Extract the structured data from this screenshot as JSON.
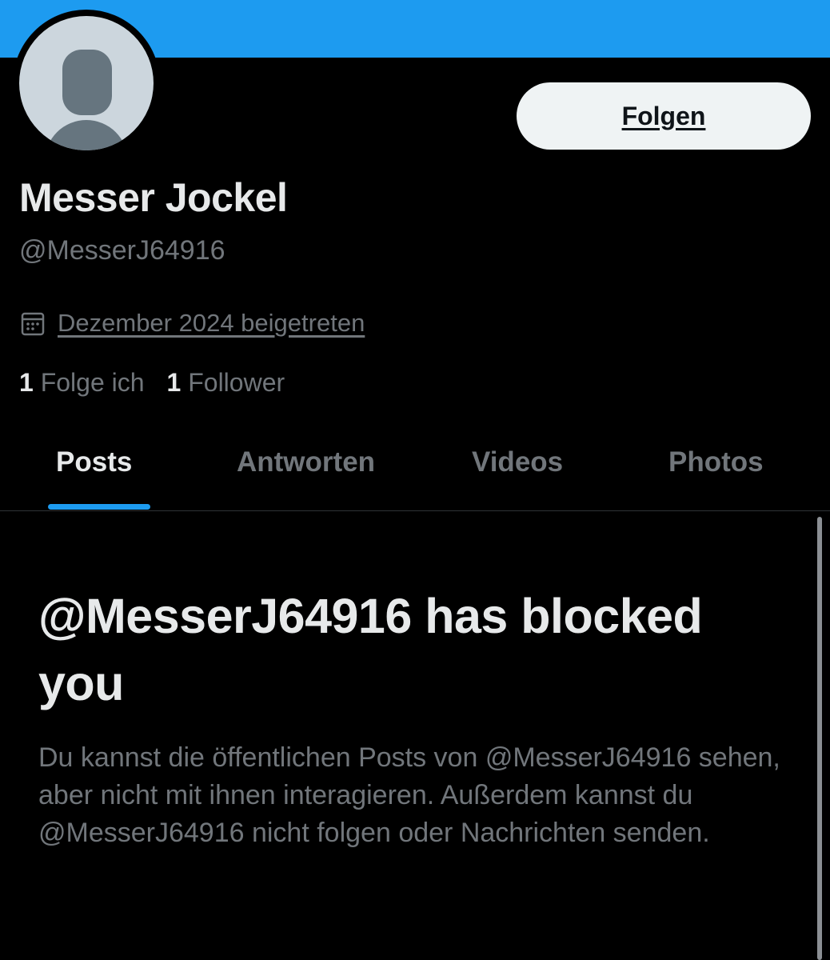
{
  "header": {
    "banner_color": "#1d9bf0"
  },
  "profile": {
    "avatar_icon": "default-avatar-icon",
    "follow_label": "Folgen",
    "display_name": "Messer Jockel",
    "handle": "@MesserJ64916",
    "joined_icon": "calendar-icon",
    "joined_text": "Dezember 2024 beigetreten",
    "following_count": "1",
    "following_label": "Folge ich",
    "followers_count": "1",
    "followers_label": "Follower"
  },
  "tabs": [
    {
      "label": "Posts",
      "active": true
    },
    {
      "label": "Antworten",
      "active": false
    },
    {
      "label": "Videos",
      "active": false
    },
    {
      "label": "Photos",
      "active": false
    }
  ],
  "blocked": {
    "title": "@MesserJ64916 has blocked you",
    "description": "Du kannst die öffentlichen Posts von @MesserJ64916 sehen, aber nicht mit ihnen interagieren. Außerdem kannst du @MesserJ64916 nicht folgen oder Nachrichten senden."
  },
  "colors": {
    "accent": "#1d9bf0",
    "background": "#000000",
    "primary_text": "#e7e9ea",
    "secondary_text": "#71767b"
  }
}
